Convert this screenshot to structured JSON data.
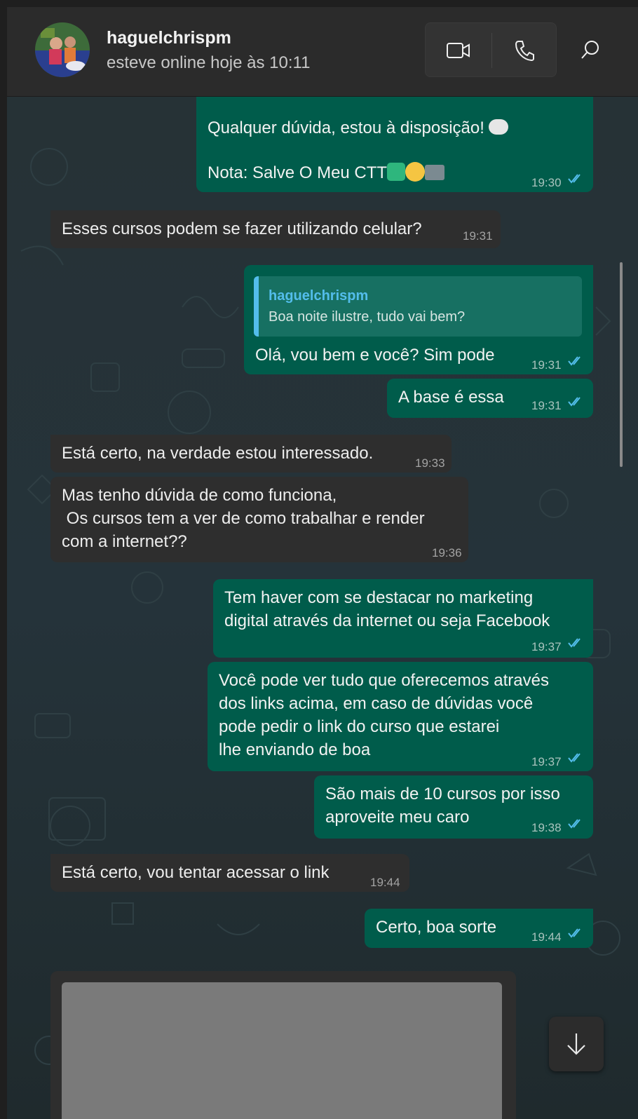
{
  "header": {
    "contact_name": "haguelchrispm",
    "contact_status": "esteve online hoje às 10:11",
    "video_call_icon": "video-camera-icon",
    "voice_call_icon": "phone-icon",
    "search_icon": "search-icon"
  },
  "colors": {
    "outgoing_bubble": "#005c4b",
    "incoming_bubble": "#2e2e2e",
    "read_ticks": "#53bdeb",
    "quote_accent": "#53bdeb"
  },
  "messages": [
    {
      "dir": "out",
      "line1": "Qualquer dúvida, estou à disposição!",
      "line2": "Nota: Salve O Meu CTT",
      "time": "19:30"
    },
    {
      "dir": "in",
      "text": "Esses cursos podem se fazer utilizando celular?",
      "time": "19:31"
    },
    {
      "dir": "out",
      "quote_author": "haguelchrispm",
      "quote_text": "Boa noite ilustre,  tudo vai bem?",
      "text": "Olá, vou bem e você? Sim pode",
      "time": "19:31"
    },
    {
      "dir": "out",
      "text": "A base é essa",
      "time": "19:31"
    },
    {
      "dir": "in",
      "text": "Está certo, na verdade estou interessado.",
      "time": "19:33"
    },
    {
      "dir": "in",
      "text": "Mas tenho dúvida de como funciona,\n Os cursos tem a ver de como trabalhar e render\ncom a internet??",
      "time": "19:36"
    },
    {
      "dir": "out",
      "text": "Tem haver com se destacar no marketing\ndigital através da internet ou seja Facebook",
      "time": "19:37"
    },
    {
      "dir": "out",
      "text": "Você pode ver tudo que oferecemos através\ndos links acima, em caso de dúvidas você\npode pedir o link do curso que estarei\nlhe enviando de boa",
      "time": "19:37"
    },
    {
      "dir": "out",
      "text": "São mais de 10 cursos por isso\naproveite meu caro",
      "time": "19:38"
    },
    {
      "dir": "in",
      "text": "Está certo, vou tentar acessar o link",
      "time": "19:44"
    },
    {
      "dir": "out",
      "text": "Certo, boa sorte",
      "time": "19:44"
    }
  ],
  "scroll_down_icon": "arrow-down-icon"
}
